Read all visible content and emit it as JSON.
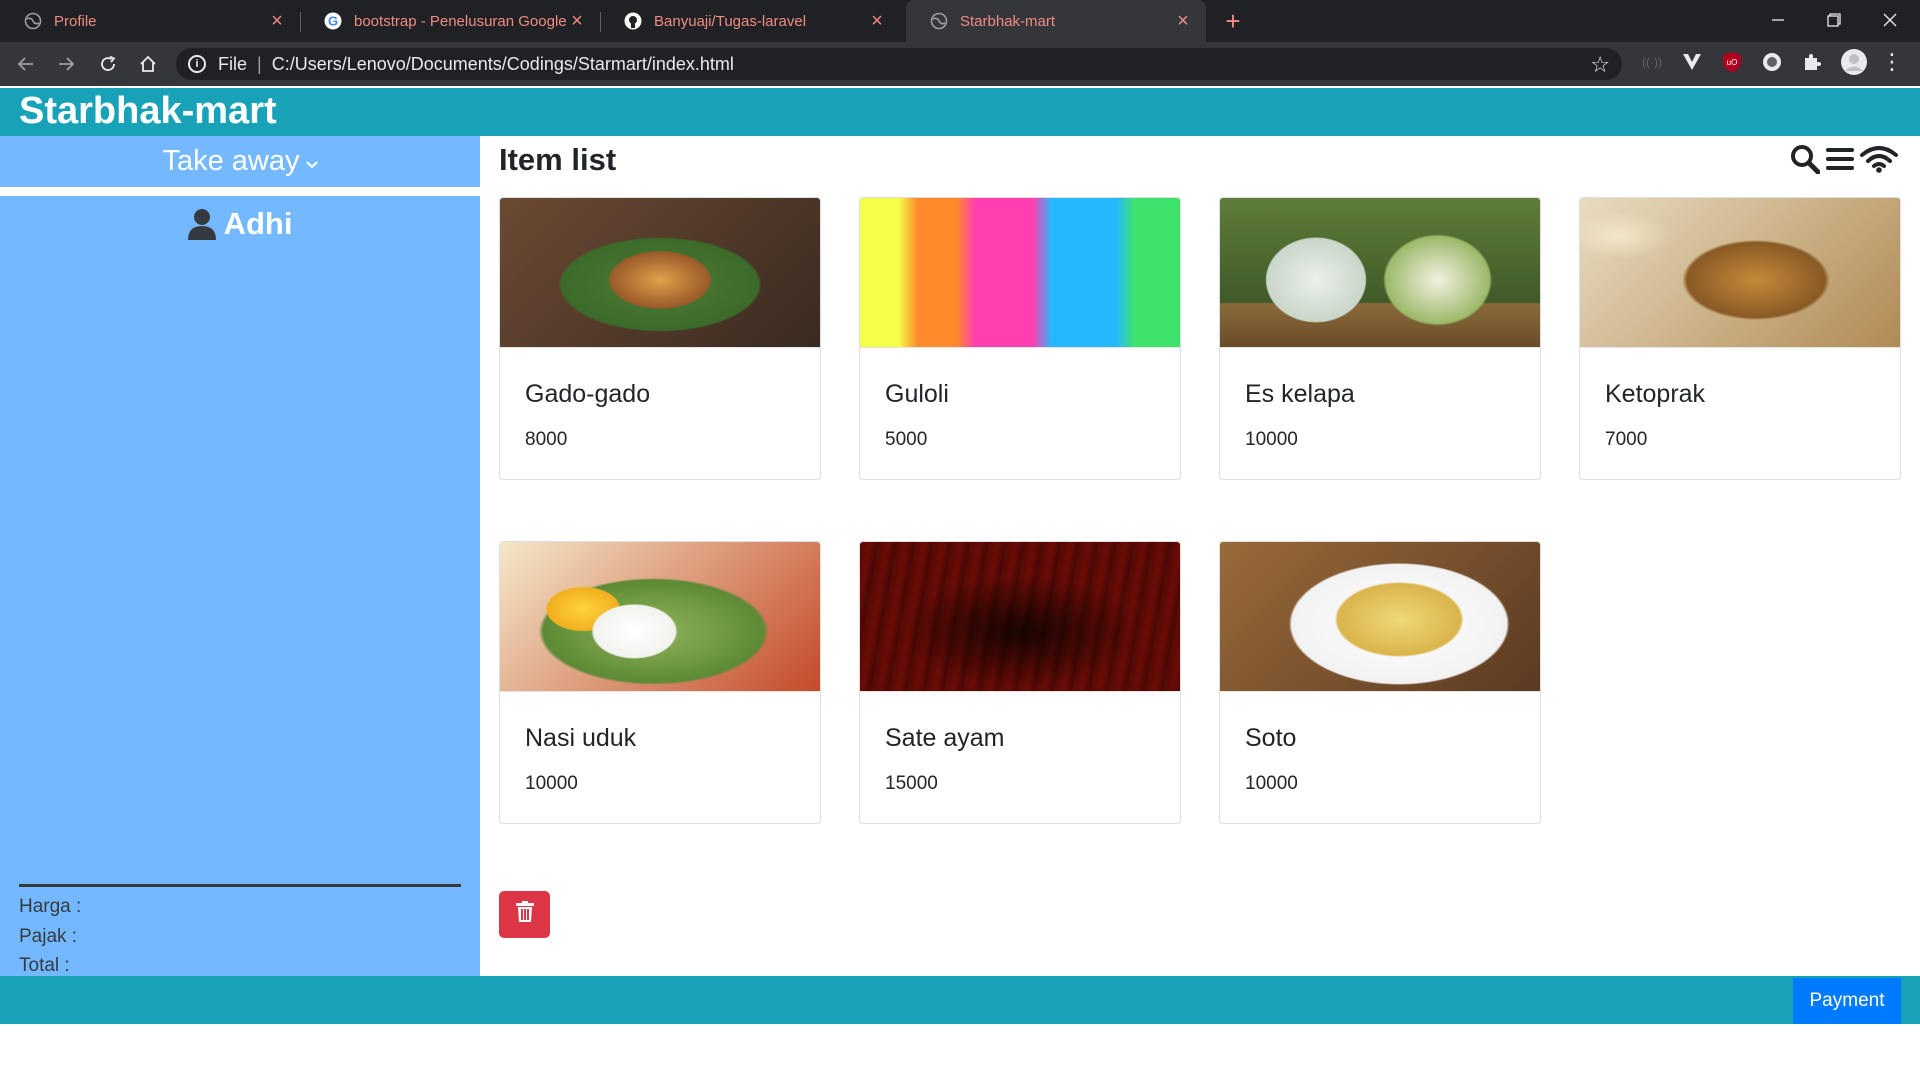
{
  "browser": {
    "tabs": [
      {
        "title": "Profile",
        "icon": "globe-icon"
      },
      {
        "title": "bootstrap - Penelusuran Google",
        "icon": "google-icon"
      },
      {
        "title": "Banyuaji/Tugas-laravel",
        "icon": "github-icon"
      },
      {
        "title": "Starbhak-mart",
        "icon": "globe-icon",
        "active": true
      }
    ],
    "new_tab": "+",
    "url_scheme": "File",
    "url": "C:/Users/Lenovo/Documents/Codings/Starmart/index.html"
  },
  "app": {
    "brand": "Starbhak-mart",
    "order_type": "Take away",
    "customer": "Adhi",
    "totals": {
      "harga": "Harga :",
      "pajak": "Pajak :",
      "total": "Total :"
    },
    "page_title": "Item list",
    "items": [
      {
        "name": "Gado-gado",
        "price": "8000"
      },
      {
        "name": "Guloli",
        "price": "5000"
      },
      {
        "name": "Es kelapa",
        "price": "10000"
      },
      {
        "name": "Ketoprak",
        "price": "7000"
      },
      {
        "name": "Nasi uduk",
        "price": "10000"
      },
      {
        "name": "Sate ayam",
        "price": "15000"
      },
      {
        "name": "Soto",
        "price": "10000"
      }
    ],
    "payment_label": "Payment"
  },
  "colors": {
    "header": "#17a2b8",
    "sidebar": "#74b9ff",
    "danger": "#dc3545",
    "primary": "#007bff"
  }
}
